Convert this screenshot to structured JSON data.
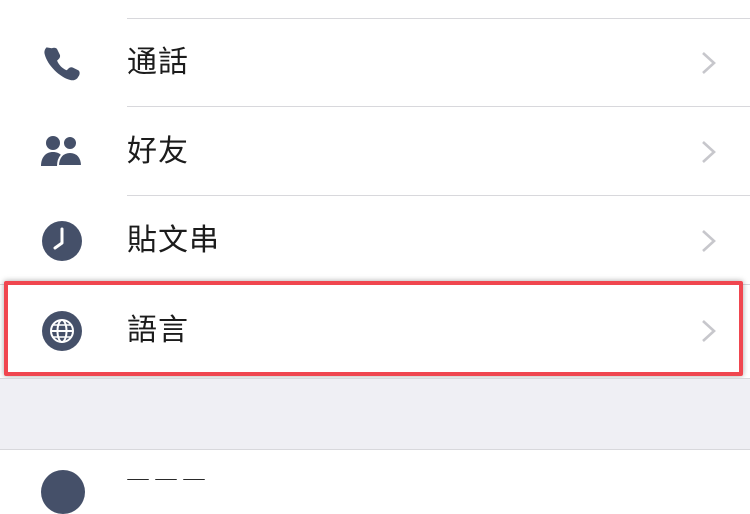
{
  "settings": {
    "items": [
      {
        "label": "通話",
        "icon": "phone-icon"
      },
      {
        "label": "好友",
        "icon": "friends-icon"
      },
      {
        "label": "貼文串",
        "icon": "clock-icon"
      },
      {
        "label": "語言",
        "icon": "globe-icon",
        "highlighted": true
      }
    ]
  },
  "colors": {
    "icon": "#455069",
    "chevron": "#c7c7cc",
    "divider": "#d8d8dc",
    "section_gap": "#efeff4",
    "highlight": "#f0464f"
  }
}
